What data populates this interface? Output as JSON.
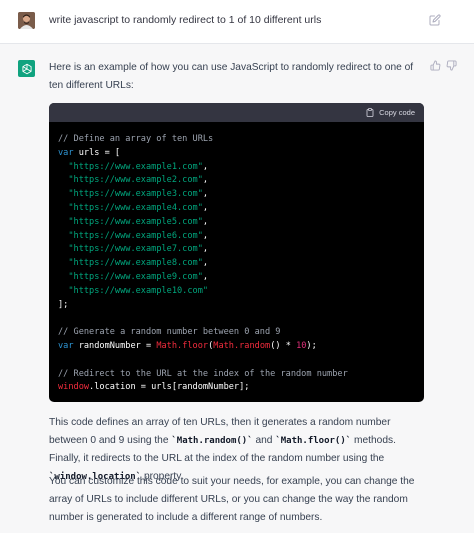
{
  "user_message": {
    "text": "write javascript to randomly redirect to 1 of 10 different urls"
  },
  "assistant": {
    "intro": "Here is an example of how you can use JavaScript to randomly redirect to one of ten different URLs:",
    "copy_label": "Copy code",
    "code": {
      "comment1": "// Define an array of ten URLs",
      "kw_var1": "var",
      "urls_decl": " urls = [",
      "urls": [
        "\"https://www.example1.com\"",
        "\"https://www.example2.com\"",
        "\"https://www.example3.com\"",
        "\"https://www.example4.com\"",
        "\"https://www.example5.com\"",
        "\"https://www.example6.com\"",
        "\"https://www.example7.com\"",
        "\"https://www.example8.com\"",
        "\"https://www.example9.com\"",
        "\"https://www.example10.com\""
      ],
      "close_array": "];",
      "comment2": "// Generate a random number between 0 and 9",
      "kw_var2": "var",
      "rand_decl": " randomNumber = ",
      "math_floor": "Math.floor",
      "math_random": "Math.random",
      "mult": "() * ",
      "ten": "10",
      "close_call": ");",
      "comment3": "// Redirect to the URL at the index of the random number",
      "window_obj": "window",
      "redirect_rest": ".location = urls[randomNumber];"
    },
    "explain_1": "This code defines an array of ten URLs, then it generates a random number between 0 and 9 using the ",
    "explain_code1": "`Math.random()`",
    "explain_2": " and ",
    "explain_code2": "`Math.floor()`",
    "explain_3": " methods. Finally, it redirects to the URL at the index of the random number using the ",
    "explain_code3": "`window.location`",
    "explain_4": " property.",
    "custom": "You can customize this code to suit your needs, for example, you can change the array of URLs to include different URLs, or you can change the way the random number is generated to include a different range of numbers."
  },
  "colors": {
    "assistant_bg": "#f7f7f8",
    "openai_green": "#10a37f",
    "code_bg": "#000000",
    "code_header_bg": "#343541",
    "comment": "#9ca3af",
    "keyword": "#2e95d3",
    "string": "#00a67d",
    "function": "#f22c3d",
    "number": "#df3079"
  },
  "icons": {
    "user_avatar": "user-avatar",
    "edit": "pencil-icon",
    "bot": "openai-logo-icon",
    "like": "thumbs-up-icon",
    "dislike": "thumbs-down-icon",
    "copy": "clipboard-icon"
  }
}
